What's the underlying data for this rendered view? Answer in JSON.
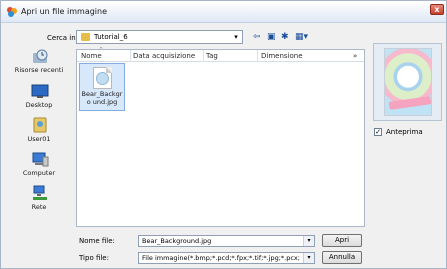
{
  "window": {
    "title": "Apri un file immagine",
    "close_glyph": "x"
  },
  "lookin": {
    "label": "Cerca in:",
    "value": "Tutorial_6",
    "arrow": "▾"
  },
  "toolbar": {
    "back": "⇦",
    "up": "▣",
    "new_folder": "✱",
    "views": "▦▾"
  },
  "places": [
    {
      "label": "Risorse recenti",
      "icon": "recent-places-icon"
    },
    {
      "label": "Desktop",
      "icon": "desktop-icon"
    },
    {
      "label": "User01",
      "icon": "user-folder-icon"
    },
    {
      "label": "Computer",
      "icon": "computer-icon"
    },
    {
      "label": "Rete",
      "icon": "network-icon"
    }
  ],
  "columns": [
    "Nome",
    "Data acquisizione",
    "Tag",
    "Dimensione",
    "»"
  ],
  "sort_indicator": "^",
  "files": [
    {
      "name": "Bear_Background.jpg",
      "name_display": "Bear_Backgro und.jpg"
    }
  ],
  "preview": {
    "checkbox_label": "Anteprima",
    "checked": true,
    "check_glyph": "✓"
  },
  "filename": {
    "label": "Nome file:",
    "value": "Bear_Background.jpg",
    "arrow": "▾"
  },
  "filetype": {
    "label": "Tipo file:",
    "value": "File immagine(*.bmp;*.pcd;*.fpx;*.tif;*.jpg;*.pcx;*.wmf;*.",
    "arrow": "▾"
  },
  "buttons": {
    "open": "Apri",
    "cancel": "Annulla"
  },
  "colors": {
    "selection": "#d7e8fb",
    "folder": "#e7bd4a",
    "link": "#1b4f9c"
  }
}
